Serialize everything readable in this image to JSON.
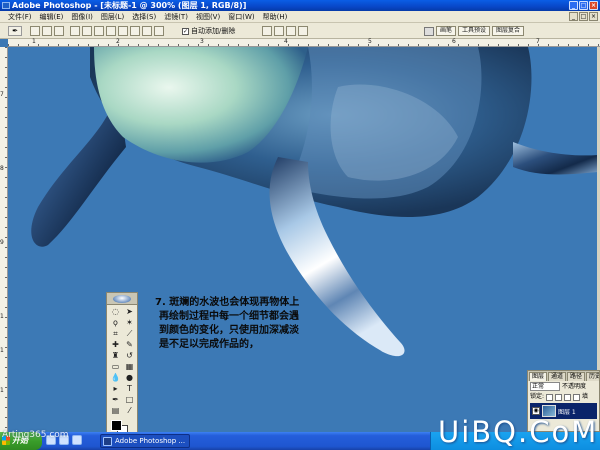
{
  "window": {
    "title": "Adobe Photoshop - [未标题-1 @ 300% (图层 1, RGB/8)]",
    "controls": [
      "_",
      "□",
      "×"
    ]
  },
  "menubar": {
    "items": [
      "文件(F)",
      "编辑(E)",
      "图像(I)",
      "图层(L)",
      "选择(S)",
      "滤镜(T)",
      "视图(V)",
      "窗口(W)",
      "帮助(H)"
    ]
  },
  "options_bar": {
    "auto_add_delete": "自动添加/删除",
    "palette_tabs": [
      "画笔",
      "工具预设",
      "图层复合"
    ]
  },
  "rulers": {
    "top_labels": [
      "1",
      "2",
      "3",
      "4",
      "5",
      "6",
      "7"
    ],
    "left_labels": [
      "7",
      "8",
      "9",
      "1",
      "1",
      "1"
    ]
  },
  "caption": {
    "line1": "7. 斑斓的水波也会体现再物体上",
    "line2": "再绘制过程中每一个细节都会遇",
    "line3": "到颜色的变化，只使用加深减淡",
    "line4": "是不足以完成作品的，"
  },
  "layers_palette": {
    "tabs": [
      "图层",
      "通道",
      "路径",
      "历史记录"
    ],
    "blend_mode": "正常",
    "opacity_label": "不透明度",
    "lock_label": "锁定:",
    "fill_label": "填",
    "layer_name": "图层 1"
  },
  "taskbar": {
    "start_label": "开始",
    "task_button": "Adobe Photoshop ..."
  },
  "watermarks": {
    "left": "Arting365.com",
    "right": "UiBQ.CoM"
  },
  "colors": {
    "canvas_bg": "#3c79b5",
    "titlebar": "#0a5ee6",
    "taskbar": "#245edb",
    "start_button": "#3a9d2b"
  }
}
